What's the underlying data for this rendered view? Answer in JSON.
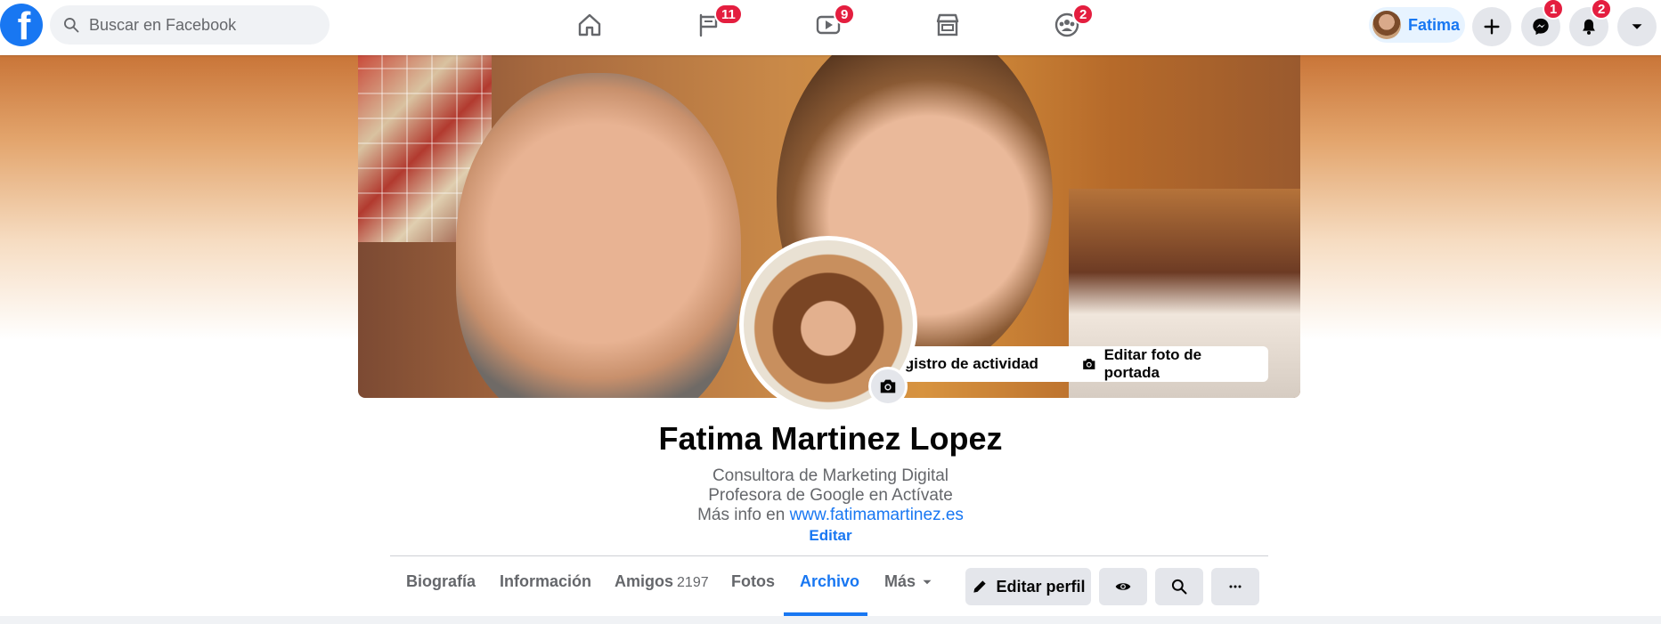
{
  "search": {
    "placeholder": "Buscar en Facebook"
  },
  "nav": {
    "badges": {
      "pages": "11",
      "watch": "9",
      "groups": "2"
    }
  },
  "account": {
    "name": "Fatima",
    "messenger_badge": "1",
    "notifications_badge": "2"
  },
  "cover": {
    "activity_button": "Registro de actividad",
    "edit_cover_button": "Editar foto de portada"
  },
  "profile": {
    "name": "Fatima Martinez Lopez",
    "bio_line1": "Consultora de Marketing Digital",
    "bio_line2": "Profesora de Google en Actívate",
    "bio_line3_prefix": "Más info en ",
    "bio_link": "www.fatimamartinez.es",
    "edit_link": "Editar"
  },
  "tabs": {
    "biografia": "Biografía",
    "informacion": "Información",
    "amigos": "Amigos",
    "amigos_count": "2197",
    "fotos": "Fotos",
    "archivo": "Archivo",
    "mas": "Más"
  },
  "actions": {
    "edit_profile": "Editar perfil"
  },
  "colors": {
    "accent": "#1877f2",
    "badge": "#e41e3f"
  }
}
